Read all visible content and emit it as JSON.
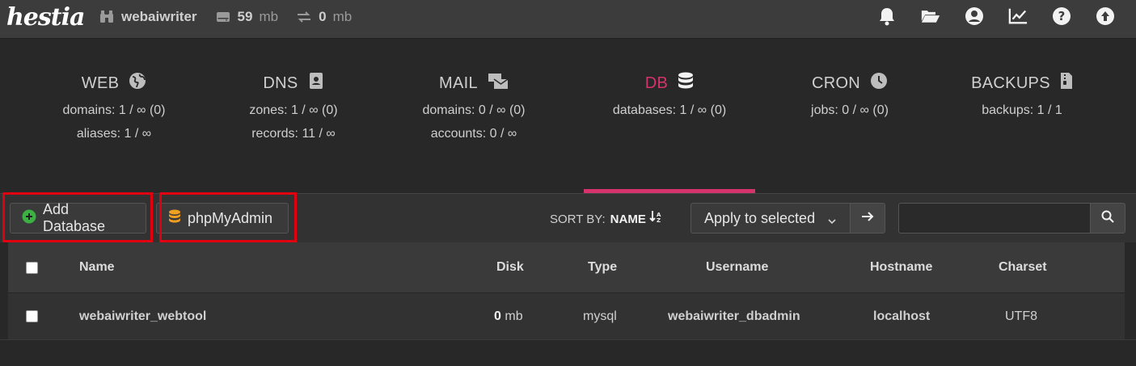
{
  "header": {
    "logo": "hestia",
    "user": "webaiwriter",
    "disk_value": "59",
    "disk_unit": "mb",
    "bandwidth_value": "0",
    "bandwidth_unit": "mb",
    "icons": [
      "bell-icon",
      "folder-open-icon",
      "user-circle-icon",
      "chart-line-icon",
      "question-icon",
      "upload-circle-icon"
    ]
  },
  "stats": [
    {
      "title": "WEB",
      "icon": "globe-icon",
      "lines": [
        "domains: 1 / ∞ (0)",
        "aliases: 1 / ∞"
      ]
    },
    {
      "title": "DNS",
      "icon": "address-book-icon",
      "lines": [
        "zones: 1 / ∞ (0)",
        "records: 11 / ∞"
      ]
    },
    {
      "title": "MAIL",
      "icon": "mail-bulk-icon",
      "lines": [
        "domains: 0 / ∞ (0)",
        "accounts: 0 / ∞"
      ]
    },
    {
      "title": "DB",
      "icon": "database-icon",
      "lines": [
        "databases: 1 / ∞ (0)"
      ],
      "active": true
    },
    {
      "title": "CRON",
      "icon": "clock-icon",
      "lines": [
        "jobs: 0 / ∞ (0)"
      ]
    },
    {
      "title": "BACKUPS",
      "icon": "file-zip-icon",
      "lines": [
        "backups: 1 / 1"
      ]
    }
  ],
  "toolbar": {
    "add_label": "Add Database",
    "pma_label": "phpMyAdmin",
    "sort_by_label": "SORT BY:",
    "sort_field": "NAME",
    "apply_label": "Apply to selected",
    "search_value": ""
  },
  "table": {
    "headers": [
      "Name",
      "Disk",
      "Type",
      "Username",
      "Hostname",
      "Charset"
    ],
    "rows": [
      {
        "name": "webaiwriter_webtool",
        "disk_value": "0",
        "disk_unit": "mb",
        "type": "mysql",
        "username": "webaiwriter_dbadmin",
        "hostname": "localhost",
        "charset": "UTF8"
      }
    ]
  },
  "colors": {
    "accent": "#d6336c",
    "add_icon": "#3cb043",
    "pma_icon": "#f0a020",
    "highlight": "#e00010"
  }
}
